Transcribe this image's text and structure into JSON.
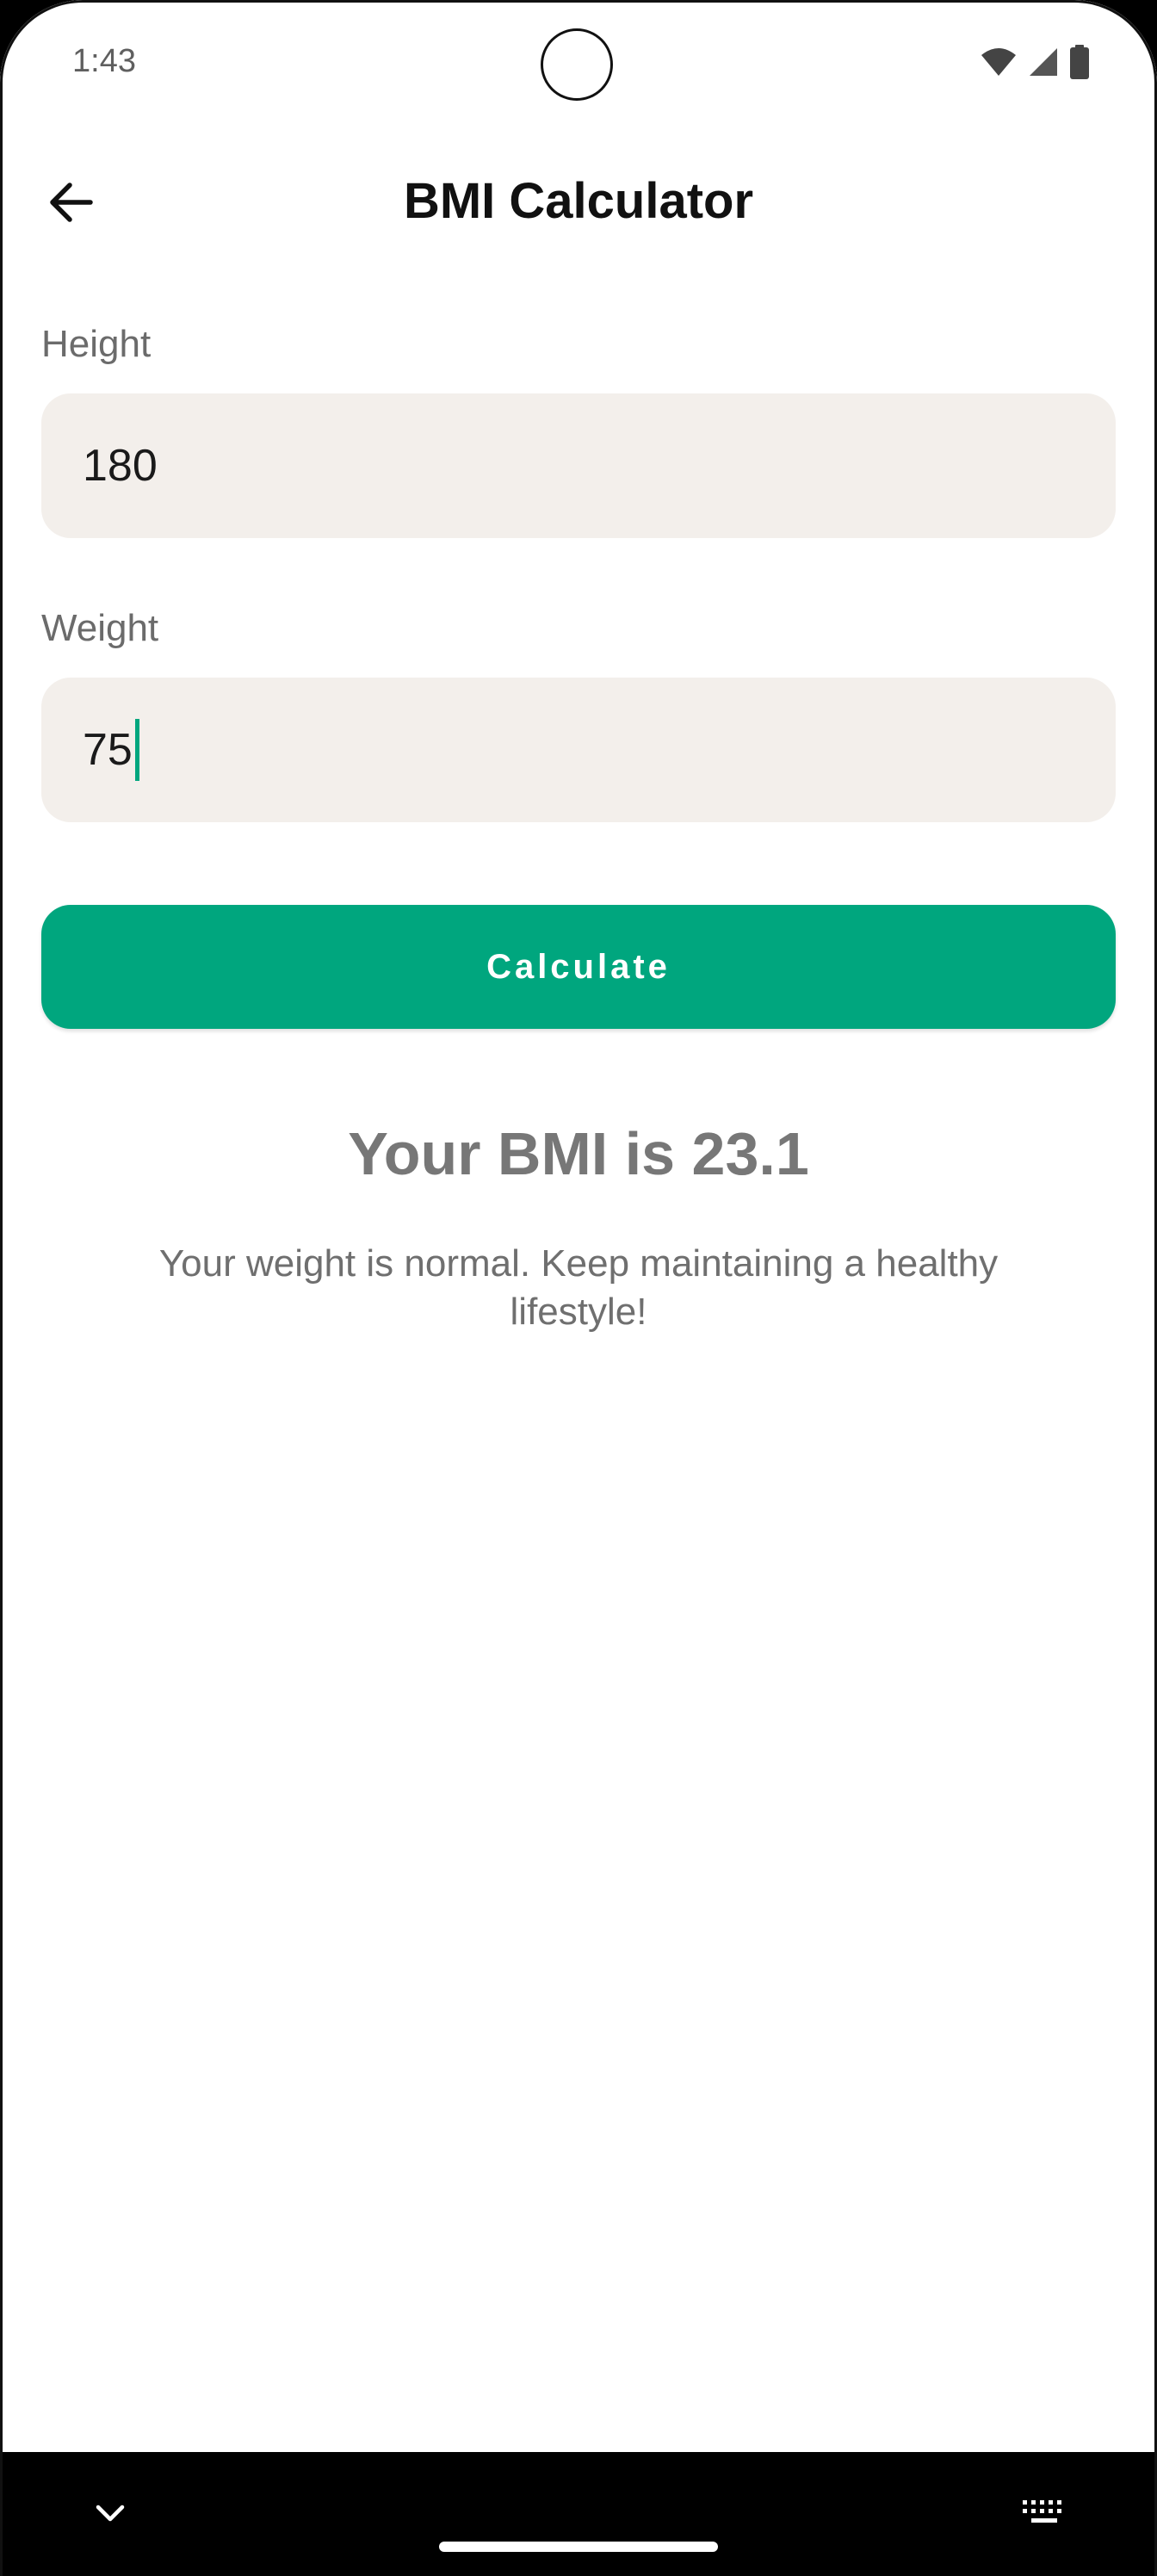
{
  "status_bar": {
    "time": "1:43"
  },
  "app_bar": {
    "title": "BMI Calculator",
    "back_icon": "arrow-back-icon"
  },
  "form": {
    "height": {
      "label": "Height",
      "value": "180"
    },
    "weight": {
      "label": "Weight",
      "value": "75"
    },
    "calculate_label": "Calculate"
  },
  "result": {
    "title": "Your BMI is 23.1",
    "description": "Your weight is normal. Keep maintaining a healthy lifestyle!"
  },
  "nav_bar": {
    "left_icon": "chevron-down-icon",
    "right_icon": "keyboard-icon"
  },
  "colors": {
    "accent": "#00a67e",
    "field_background": "#f3efeb",
    "result_text": "#777777"
  }
}
